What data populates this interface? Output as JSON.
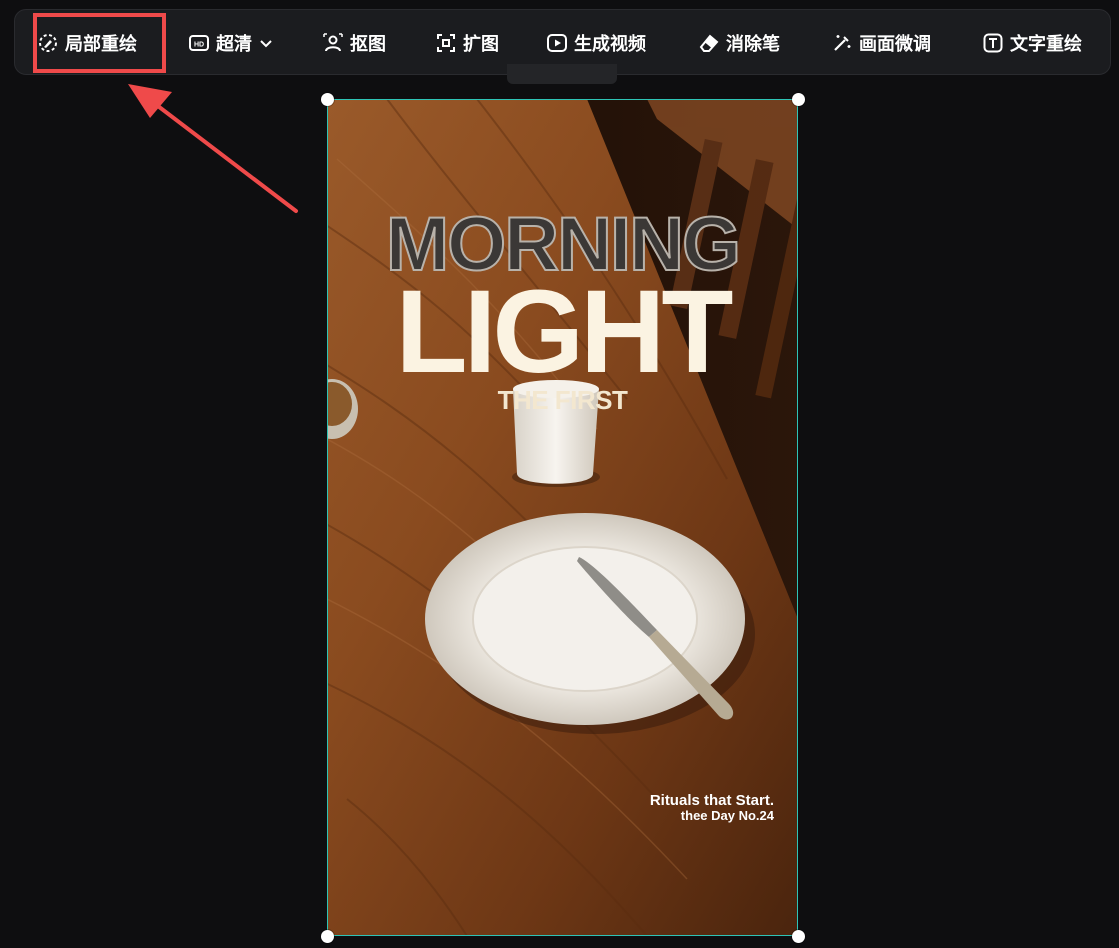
{
  "toolbar": {
    "items": [
      {
        "label": "局部重绘",
        "icon": "inpaint-brush-icon"
      },
      {
        "label": "超清",
        "icon": "hd-icon",
        "has_dropdown": true
      },
      {
        "label": "抠图",
        "icon": "cutout-person-icon"
      },
      {
        "label": "扩图",
        "icon": "expand-frame-icon"
      },
      {
        "label": "生成视频",
        "icon": "play-video-icon"
      },
      {
        "label": "消除笔",
        "icon": "eraser-icon"
      },
      {
        "label": "画面微调",
        "icon": "magic-wand-icon"
      },
      {
        "label": "文字重绘",
        "icon": "text-box-icon"
      }
    ]
  },
  "annotation": {
    "highlighted_item": "局部重绘",
    "color": "#ef4a4a"
  },
  "poster": {
    "title_line1": "MORNING",
    "title_line2": "LIGHT",
    "subtitle": "THE FIRST",
    "tagline_line1": "Rituals that Start.",
    "tagline_line2": "thee Day No.24"
  },
  "colors": {
    "background": "#0e0e10",
    "toolbar_bg": "#1b1c1f",
    "selection_border": "#2ec4b6"
  }
}
